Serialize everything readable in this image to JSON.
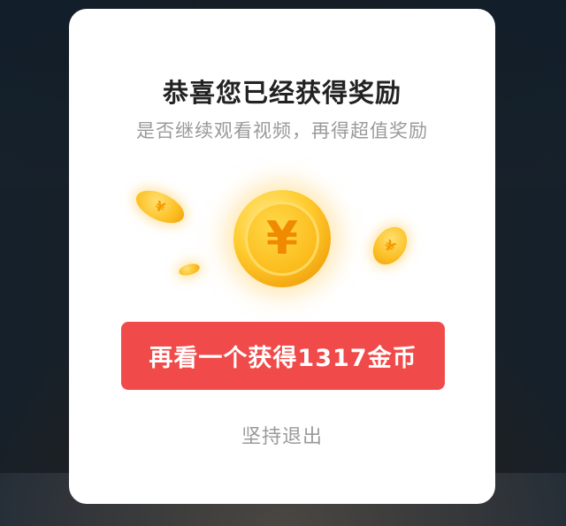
{
  "dialog": {
    "title": "恭喜您已经获得奖励",
    "subtitle": "是否继续观看视频，再得超值奖励",
    "coin_symbol": "¥",
    "primary_button": "再看一个获得1317金币",
    "exit_link": "坚持退出"
  },
  "colors": {
    "primary": "#f04a4a",
    "coin": "#fbbb1a"
  }
}
